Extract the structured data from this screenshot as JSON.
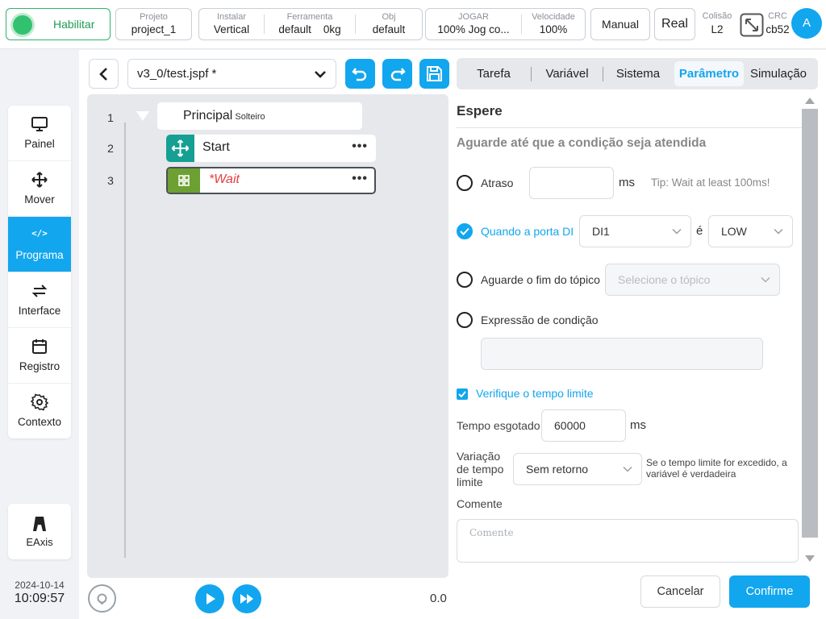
{
  "topbar": {
    "enable_label": "Habilitar",
    "project": {
      "caption": "Projeto",
      "value": "project_1"
    },
    "install": {
      "caption": "Instalar",
      "value": "Vertical"
    },
    "tool": {
      "caption": "Ferramenta",
      "value": "default",
      "load": "0kg"
    },
    "obj": {
      "caption": "Obj",
      "value": "default"
    },
    "jog": {
      "caption": "JOGAR",
      "value": "100%  Jog co..."
    },
    "speed": {
      "caption": "Velocidade",
      "value": "100%"
    },
    "mode_label": "Manual",
    "real_label": "Real",
    "collision": {
      "caption": "Colisão",
      "value": "L2"
    },
    "crc": {
      "caption": "CRC",
      "value": "cb52"
    },
    "avatar_letter": "A"
  },
  "nav": {
    "items": [
      {
        "label": "Painel",
        "icon": "monitor-icon"
      },
      {
        "label": "Mover",
        "icon": "move-icon"
      },
      {
        "label": "Programa",
        "icon": "code-icon",
        "glyph": "</>"
      },
      {
        "label": "Interface",
        "icon": "swap-icon"
      },
      {
        "label": "Registro",
        "icon": "calendar-icon"
      },
      {
        "label": "Contexto",
        "icon": "gear-icon"
      }
    ],
    "eaxis_label": "EAxis"
  },
  "datetime": {
    "date": "2024-10-14",
    "time": "10:09:57"
  },
  "editor": {
    "file_name": "v3_0/test.jspf *",
    "lines": [
      "1",
      "2",
      "3"
    ],
    "root": {
      "label": "Principal",
      "sub": "Solteiro"
    },
    "nodes": [
      {
        "label": "Start",
        "icon": "move-icon",
        "dots": "•••"
      },
      {
        "label": "*Wait",
        "icon": "grid-icon",
        "dots": "•••"
      }
    ],
    "speed_readout": "0.0"
  },
  "tabs": [
    "Tarefa",
    "Variável",
    "Sistema",
    "Parâmetro",
    "Simulação"
  ],
  "param": {
    "title": "Espere",
    "subtitle": "Aguarde até que a condição seja atendida",
    "delay": {
      "label": "Atraso",
      "value": "",
      "unit": "ms",
      "tip": "Tip: Wait at least 100ms!"
    },
    "di": {
      "label": "Quando a porta DI",
      "port": "DI1",
      "is_label": "é",
      "level": "LOW"
    },
    "topic": {
      "label": "Aguarde o fim do tópico",
      "placeholder": "Selecione o tópico"
    },
    "expr": {
      "label": "Expressão de condição",
      "value": ""
    },
    "timeout_check": {
      "label": "Verifique o tempo limite"
    },
    "timeout": {
      "label": "Tempo esgotado",
      "value": "60000",
      "unit": "ms"
    },
    "variation": {
      "label": "Variação de tempo limite",
      "value": "Sem retorno",
      "note": "Se o tempo limite for excedido, a variável é verdadeira"
    },
    "comment": {
      "label": "Comente",
      "placeholder": "Comente"
    }
  },
  "buttons": {
    "cancel": "Cancelar",
    "confirm": "Confirme"
  },
  "colors": {
    "accent": "#12a6ee",
    "enable": "#32c26f",
    "warning": "#e43d3d"
  }
}
